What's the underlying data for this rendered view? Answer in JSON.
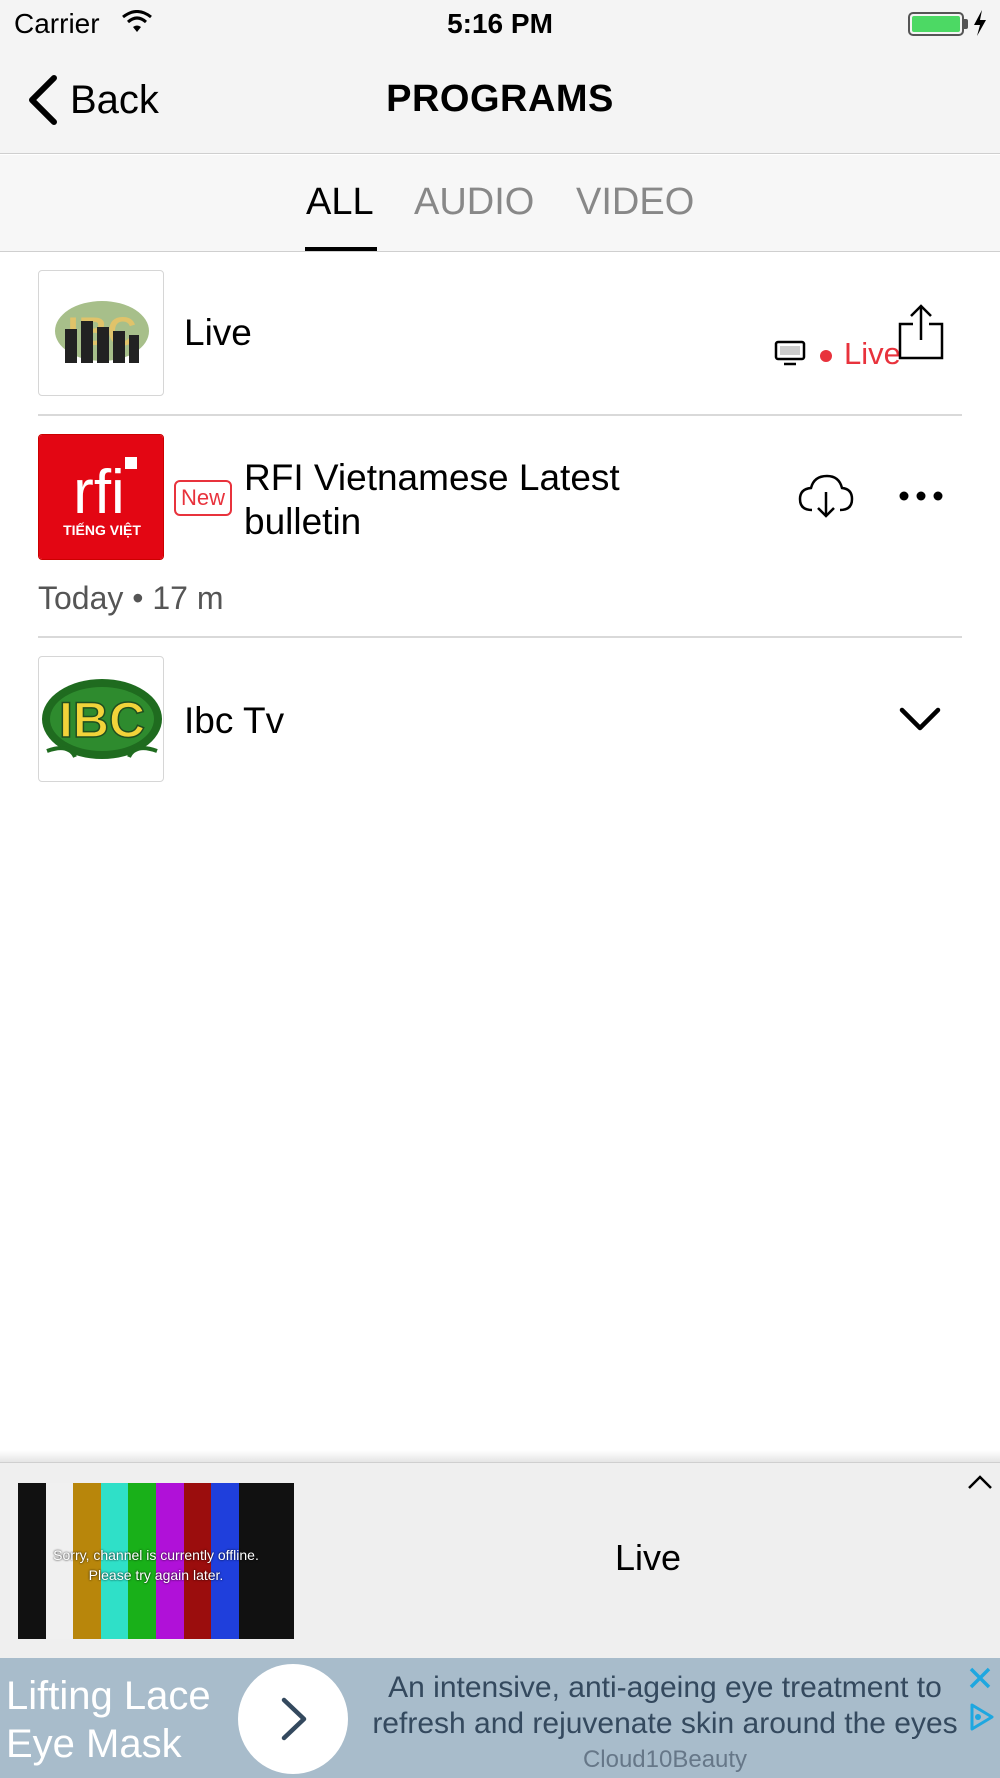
{
  "status_bar": {
    "carrier": "Carrier",
    "time": "5:16 PM",
    "icons": [
      "wifi-icon",
      "battery-icon",
      "charging-bolt-icon"
    ]
  },
  "nav": {
    "back_label": "Back",
    "title": "PROGRAMS"
  },
  "tabs": [
    {
      "label": "ALL",
      "active": true
    },
    {
      "label": "AUDIO",
      "active": false
    },
    {
      "label": "VIDEO",
      "active": false
    }
  ],
  "list": {
    "items": [
      {
        "title": "Live",
        "status_label": "Live",
        "icons": [
          "tv-icon",
          "share-icon"
        ]
      },
      {
        "badge": "New",
        "title_line1": "RFI Vietnamese Latest",
        "title_line2": "bulletin",
        "meta": "Today • 17 m",
        "logo_text_main": "rfi",
        "logo_text_sub": "TIẾNG VIỆT",
        "icons": [
          "cloud-download-icon",
          "more-icon"
        ]
      },
      {
        "title": "Ibc Tv",
        "logo_text": "IBC",
        "icons": [
          "chevron-down-icon"
        ]
      }
    ]
  },
  "player": {
    "title": "Live",
    "offline_line1": "Sorry, channel is currently offline.",
    "offline_line2": "Please try again later.",
    "icons": [
      "chevron-up-icon"
    ]
  },
  "ad": {
    "headline_line1": "Lifting Lace",
    "headline_line2": "Eye Mask",
    "body": "An intensive, anti-ageing eye treatment to refresh and rejuvenate skin around the eyes",
    "advertiser": "Cloud10Beauty",
    "icons": [
      "chevron-right-icon",
      "close-icon",
      "adchoices-icon"
    ]
  },
  "colors": {
    "accent_live": "#e8323c",
    "rfi_red": "#e30613",
    "ibc_green": "#1f6b1f",
    "ibc_yellow": "#f2d33a",
    "ad_background": "#a8bccb",
    "battery_green": "#4cd964"
  }
}
